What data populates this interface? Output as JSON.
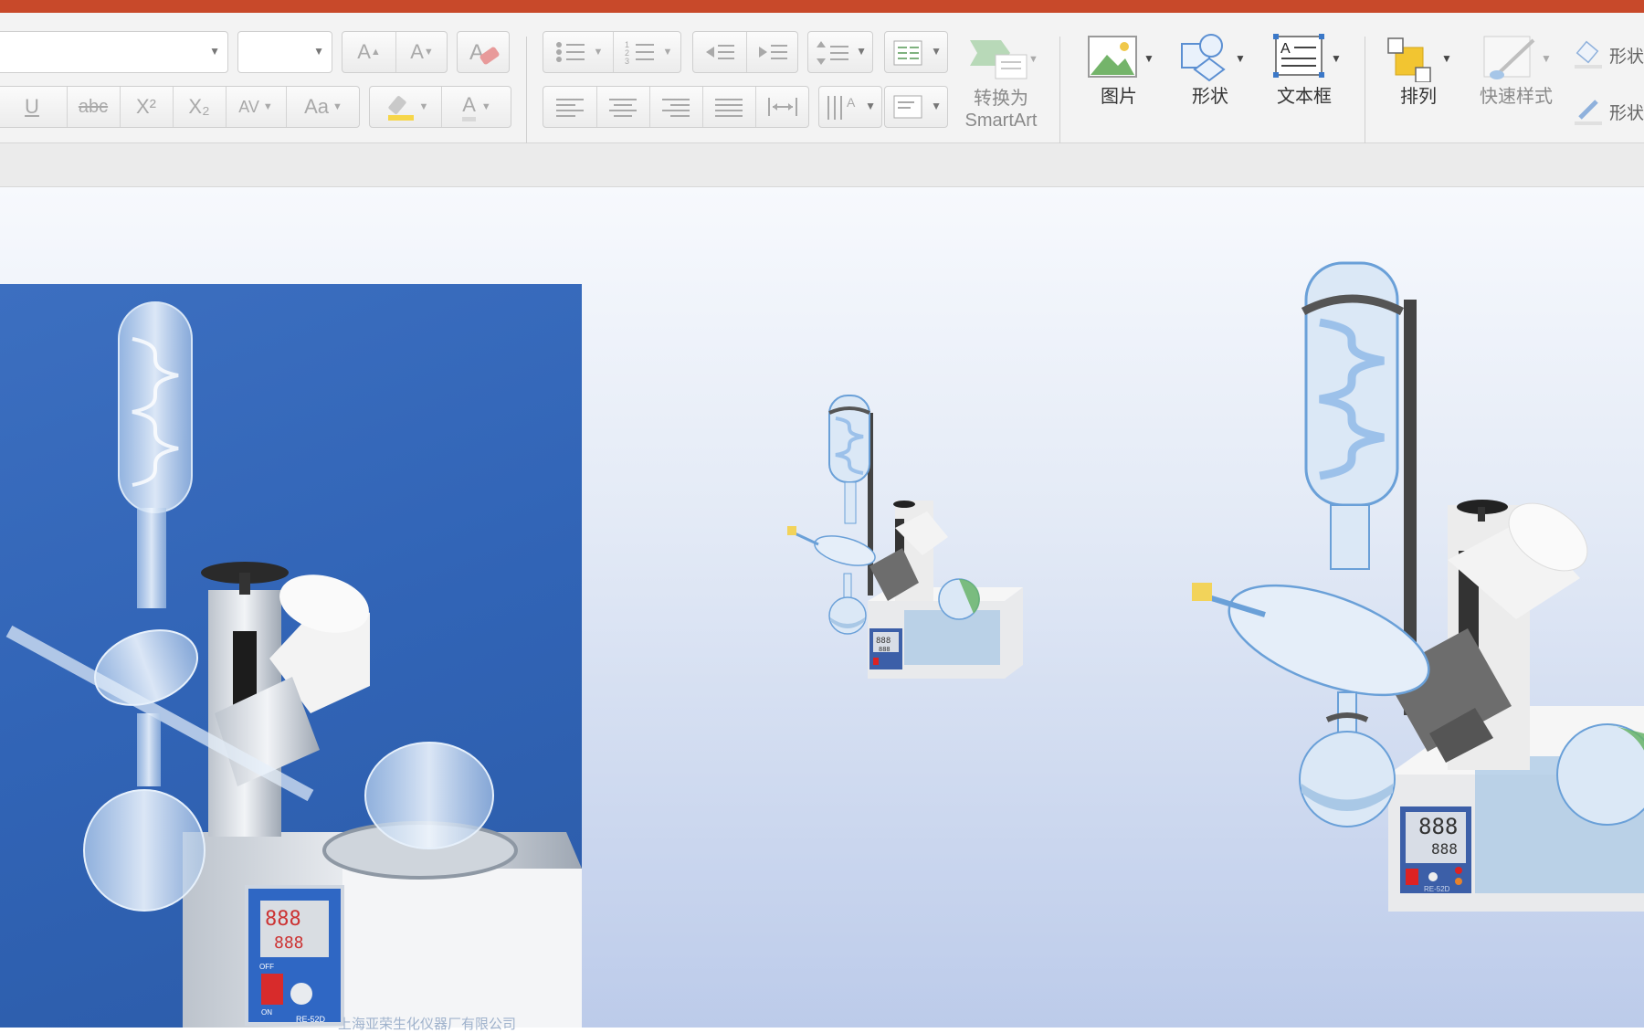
{
  "ribbon": {
    "font_row": {
      "underline": "U",
      "strike": "abc",
      "superscript": "X²",
      "subscript": "X₂",
      "spacing": "AV",
      "case": "Aa",
      "color_a": "A",
      "grow": "A",
      "shrink": "A"
    },
    "smartart": {
      "line1": "转换为",
      "line2": "SmartArt"
    },
    "picture": {
      "label": "图片"
    },
    "shape": {
      "label": "形状"
    },
    "textbox": {
      "label": "文本框"
    },
    "arrange": {
      "label": "排列"
    },
    "quick_styles": {
      "label": "快速样式"
    },
    "shape_fill": {
      "label": "形状"
    },
    "shape_outline": {
      "label": "形状"
    }
  },
  "slide": {
    "small_display": {
      "top": "888",
      "bottom": "888"
    },
    "large_display": {
      "top": "888",
      "bottom": "888",
      "model": "RE-52D"
    },
    "photo": {
      "display_top": "888",
      "display_bottom": "888",
      "label_off": "OFF",
      "label_on": "ON",
      "model": "RE-52D",
      "watermark": "上海亚荣生化仪器厂有限公司"
    }
  },
  "colors": {
    "accent_bar": "#c8492a",
    "glass": "#6aa0d8",
    "panel": "#3c5fa8"
  }
}
